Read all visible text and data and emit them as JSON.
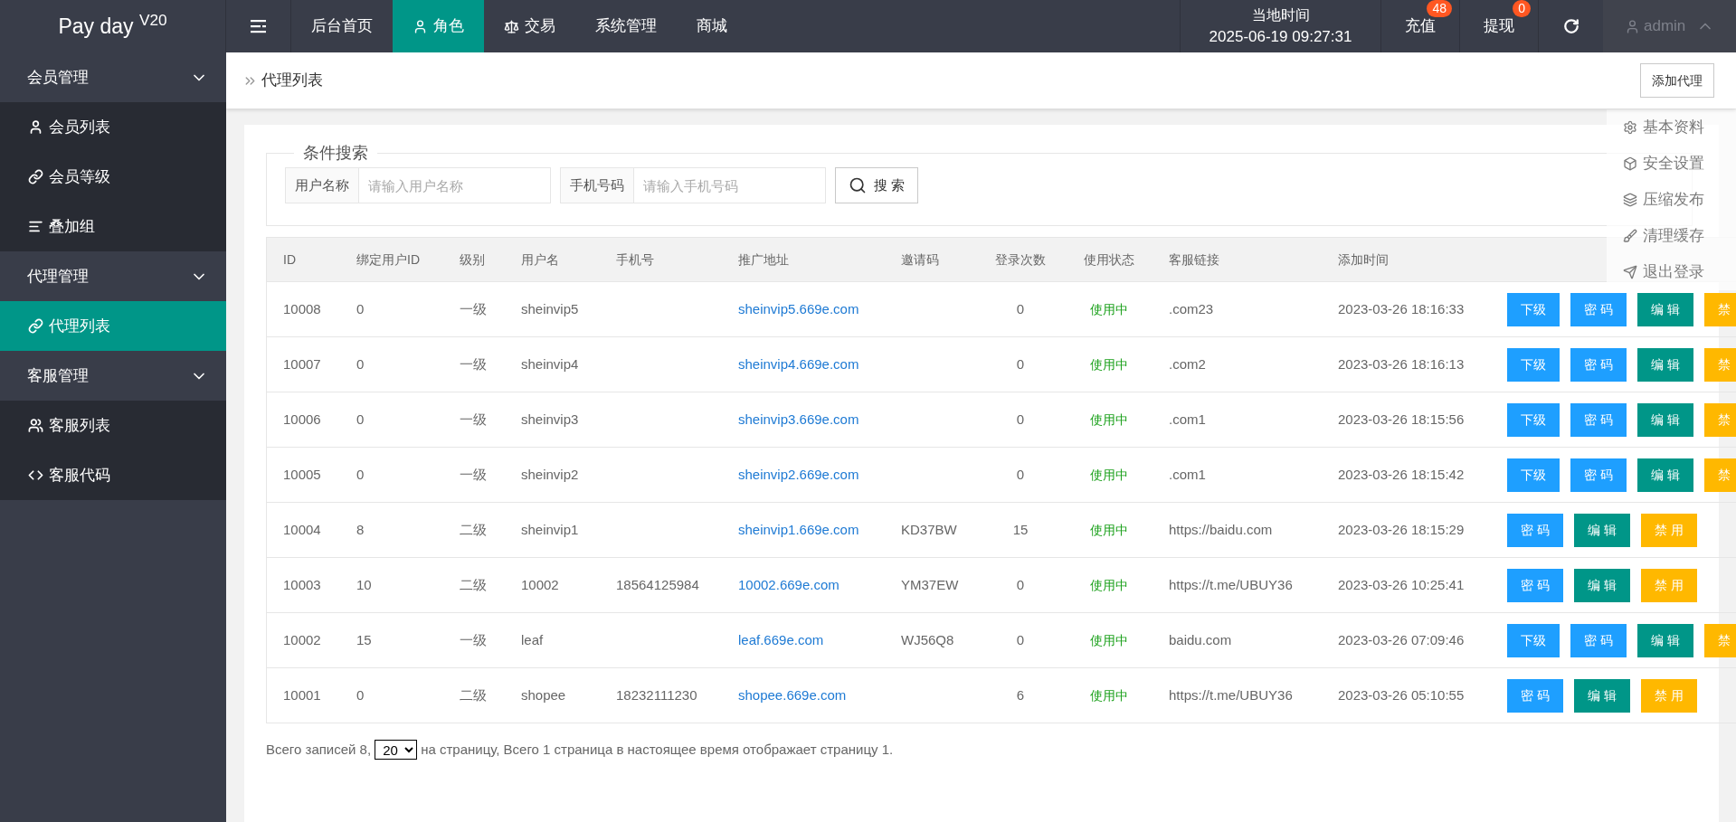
{
  "logo": "Pay day $^{V20}$",
  "nav": [
    {
      "label": "后台首页",
      "selected": false
    },
    {
      "label": "角色",
      "selected": true
    },
    {
      "label": "交易",
      "selected": false
    },
    {
      "label": "系统管理",
      "selected": false
    },
    {
      "label": "商城",
      "selected": false
    }
  ],
  "clock": {
    "label": "当地时间",
    "value": "2025-06-19 09:27:31"
  },
  "top_actions": [
    {
      "label": "充值",
      "badge": "48"
    },
    {
      "label": "提现",
      "badge": "0"
    }
  ],
  "user": {
    "name": "admin",
    "expanded": true
  },
  "user_menu": [
    "基本资料",
    "安全设置",
    "压缩发布",
    "清理缓存",
    "退出登录"
  ],
  "sidebar": [
    {
      "label": "会员管理",
      "expanded": true,
      "children": [
        {
          "label": "会员列表",
          "selected": false
        },
        {
          "label": "会员等级",
          "selected": false
        },
        {
          "label": "叠加组",
          "selected": false
        }
      ]
    },
    {
      "label": "代理管理",
      "expanded": true,
      "children": [
        {
          "label": "代理列表",
          "selected": true
        }
      ]
    },
    {
      "label": "客服管理",
      "expanded": true,
      "children": [
        {
          "label": "客服列表",
          "selected": false
        },
        {
          "label": "客服代码",
          "selected": false
        }
      ]
    }
  ],
  "breadcrumb": "代理列表",
  "add_button": "添加代理",
  "search": {
    "legend": "条件搜索",
    "fields": [
      {
        "label": "用户名称",
        "placeholder": "请输入用户名称"
      },
      {
        "label": "手机号码",
        "placeholder": "请输入手机号码"
      }
    ],
    "button": "搜 索"
  },
  "table": {
    "columns": [
      "ID",
      "绑定用户ID",
      "级别",
      "用户名",
      "手机号",
      "推广地址",
      "邀请码",
      "登录次数",
      "使用状态",
      "客服链接",
      "添加时间"
    ],
    "rows": [
      {
        "cells": [
          "10008",
          "0",
          "一级",
          "sheinvip5",
          "",
          "sheinvip5.669e.com",
          "",
          "0",
          "使用中",
          ".com23",
          "2023-03-26 18:16:33"
        ],
        "actions": [
          {
            "label": "下级",
            "kind": "sub"
          },
          {
            "label": "密 码",
            "kind": "password"
          },
          {
            "label": "编 辑",
            "kind": "edit"
          },
          {
            "label": "禁",
            "kind": "disable"
          }
        ]
      },
      {
        "cells": [
          "10007",
          "0",
          "一级",
          "sheinvip4",
          "",
          "sheinvip4.669e.com",
          "",
          "0",
          "使用中",
          ".com2",
          "2023-03-26 18:16:13"
        ],
        "actions": [
          {
            "label": "下级",
            "kind": "sub"
          },
          {
            "label": "密 码",
            "kind": "password"
          },
          {
            "label": "编 辑",
            "kind": "edit"
          },
          {
            "label": "禁",
            "kind": "disable"
          }
        ]
      },
      {
        "cells": [
          "10006",
          "0",
          "一级",
          "sheinvip3",
          "",
          "sheinvip3.669e.com",
          "",
          "0",
          "使用中",
          ".com1",
          "2023-03-26 18:15:56"
        ],
        "actions": [
          {
            "label": "下级",
            "kind": "sub"
          },
          {
            "label": "密 码",
            "kind": "password"
          },
          {
            "label": "编 辑",
            "kind": "edit"
          },
          {
            "label": "禁",
            "kind": "disable"
          }
        ]
      },
      {
        "cells": [
          "10005",
          "0",
          "一级",
          "sheinvip2",
          "",
          "sheinvip2.669e.com",
          "",
          "0",
          "使用中",
          ".com1",
          "2023-03-26 18:15:42"
        ],
        "actions": [
          {
            "label": "下级",
            "kind": "sub"
          },
          {
            "label": "密 码",
            "kind": "password"
          },
          {
            "label": "编 辑",
            "kind": "edit"
          },
          {
            "label": "禁",
            "kind": "disable"
          }
        ]
      },
      {
        "cells": [
          "10004",
          "8",
          "二级",
          "sheinvip1",
          "",
          "sheinvip1.669e.com",
          "KD37BW",
          "15",
          "使用中",
          "https://baidu.com",
          "2023-03-26 18:15:29"
        ],
        "actions": [
          {
            "label": "密 码",
            "kind": "password"
          },
          {
            "label": "编 辑",
            "kind": "edit"
          },
          {
            "label": "禁 用",
            "kind": "disable"
          }
        ]
      },
      {
        "cells": [
          "10003",
          "10",
          "二级",
          "10002",
          "18564125984",
          "10002.669e.com",
          "YM37EW",
          "0",
          "使用中",
          "https://t.me/UBUY36",
          "2023-03-26 10:25:41"
        ],
        "actions": [
          {
            "label": "密 码",
            "kind": "password"
          },
          {
            "label": "编 辑",
            "kind": "edit"
          },
          {
            "label": "禁 用",
            "kind": "disable"
          }
        ]
      },
      {
        "cells": [
          "10002",
          "15",
          "一级",
          "leaf",
          "",
          "leaf.669e.com",
          "WJ56Q8",
          "0",
          "使用中",
          "baidu.com",
          "2023-03-26 07:09:46"
        ],
        "actions": [
          {
            "label": "下级",
            "kind": "sub"
          },
          {
            "label": "密 码",
            "kind": "password"
          },
          {
            "label": "编 辑",
            "kind": "edit"
          },
          {
            "label": "禁",
            "kind": "disable"
          }
        ]
      },
      {
        "cells": [
          "10001",
          "0",
          "二级",
          "shopee",
          "18232111230",
          "shopee.669e.com",
          "",
          "6",
          "使用中",
          "https://t.me/UBUY36",
          "2023-03-26 05:10:55"
        ],
        "actions": [
          {
            "label": "密 码",
            "kind": "password"
          },
          {
            "label": "编 辑",
            "kind": "edit"
          },
          {
            "label": "禁 用",
            "kind": "disable"
          }
        ]
      }
    ]
  },
  "pager": {
    "before": "Всего записей 8,",
    "page_size": "20",
    "after": "на страницу, Всего 1 страница в настоящее время отображает страницу 1."
  }
}
